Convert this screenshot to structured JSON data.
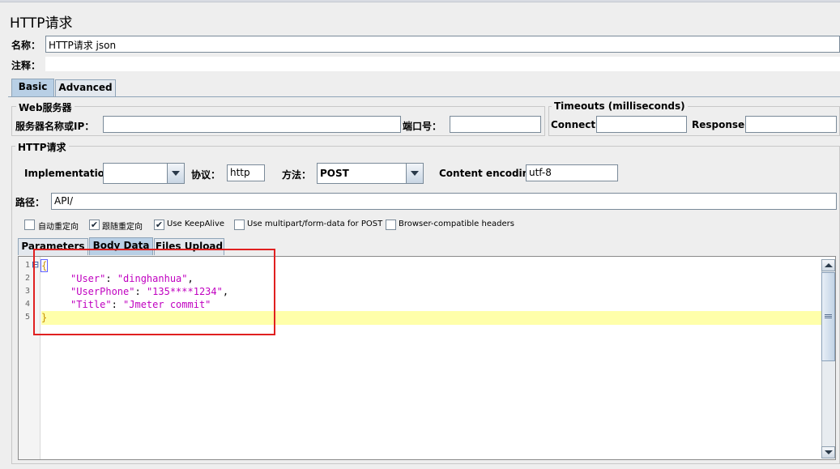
{
  "title": "HTTP请求",
  "name": {
    "label": "名称：",
    "value": "HTTP请求  json"
  },
  "comment": {
    "label": "注释：",
    "value": ""
  },
  "tabs": [
    {
      "label": "Basic",
      "active": true
    },
    {
      "label": "Advanced",
      "active": false
    }
  ],
  "web_server": {
    "title": "Web服务器",
    "server_label": "服务器名称或IP：",
    "server_value": "",
    "port_label": "端口号：",
    "port_value": ""
  },
  "timeouts": {
    "title": "Timeouts (milliseconds)",
    "connect_label": "Connect:",
    "connect_value": "",
    "response_label": "Response:",
    "response_value": ""
  },
  "http_request": {
    "title": "HTTP请求",
    "implementation_label": "Implementation:",
    "implementation_value": "",
    "protocol_label": "协议：",
    "protocol_value": "http",
    "method_label": "方法：",
    "method_value": "POST",
    "encoding_label": "Content encoding:",
    "encoding_value": "utf-8",
    "path_label": "路径：",
    "path_value": "API/"
  },
  "options": [
    {
      "label": "自动重定向",
      "checked": false
    },
    {
      "label": "跟随重定向",
      "checked": true
    },
    {
      "label": "Use KeepAlive",
      "checked": true
    },
    {
      "label": "Use multipart/form-data for POST",
      "checked": false
    },
    {
      "label": "Browser-compatible headers",
      "checked": false
    }
  ],
  "body_tabs": [
    {
      "label": "Parameters",
      "active": false
    },
    {
      "label": "Body Data",
      "active": true
    },
    {
      "label": "Files Upload",
      "active": false
    }
  ],
  "editor": {
    "line_numbers": [
      "1",
      "2",
      "3",
      "4",
      "5"
    ],
    "lines": {
      "l1": "{",
      "l2_key": "\"User\"",
      "l2_sep": ": ",
      "l2_val": "\"dinghanhua\"",
      "l2_end": ",",
      "l3_key": "\"UserPhone\"",
      "l3_sep": ": ",
      "l3_val": "\"135****1234\"",
      "l3_end": ",",
      "l4_key": "\"Title\"",
      "l4_sep": ": ",
      "l4_val": "\"Jmeter commit\"",
      "l5": "}"
    },
    "fold_glyph": "⊟",
    "highlight_color": "#ffffaa"
  },
  "annotation": {
    "color": "#e02020"
  }
}
